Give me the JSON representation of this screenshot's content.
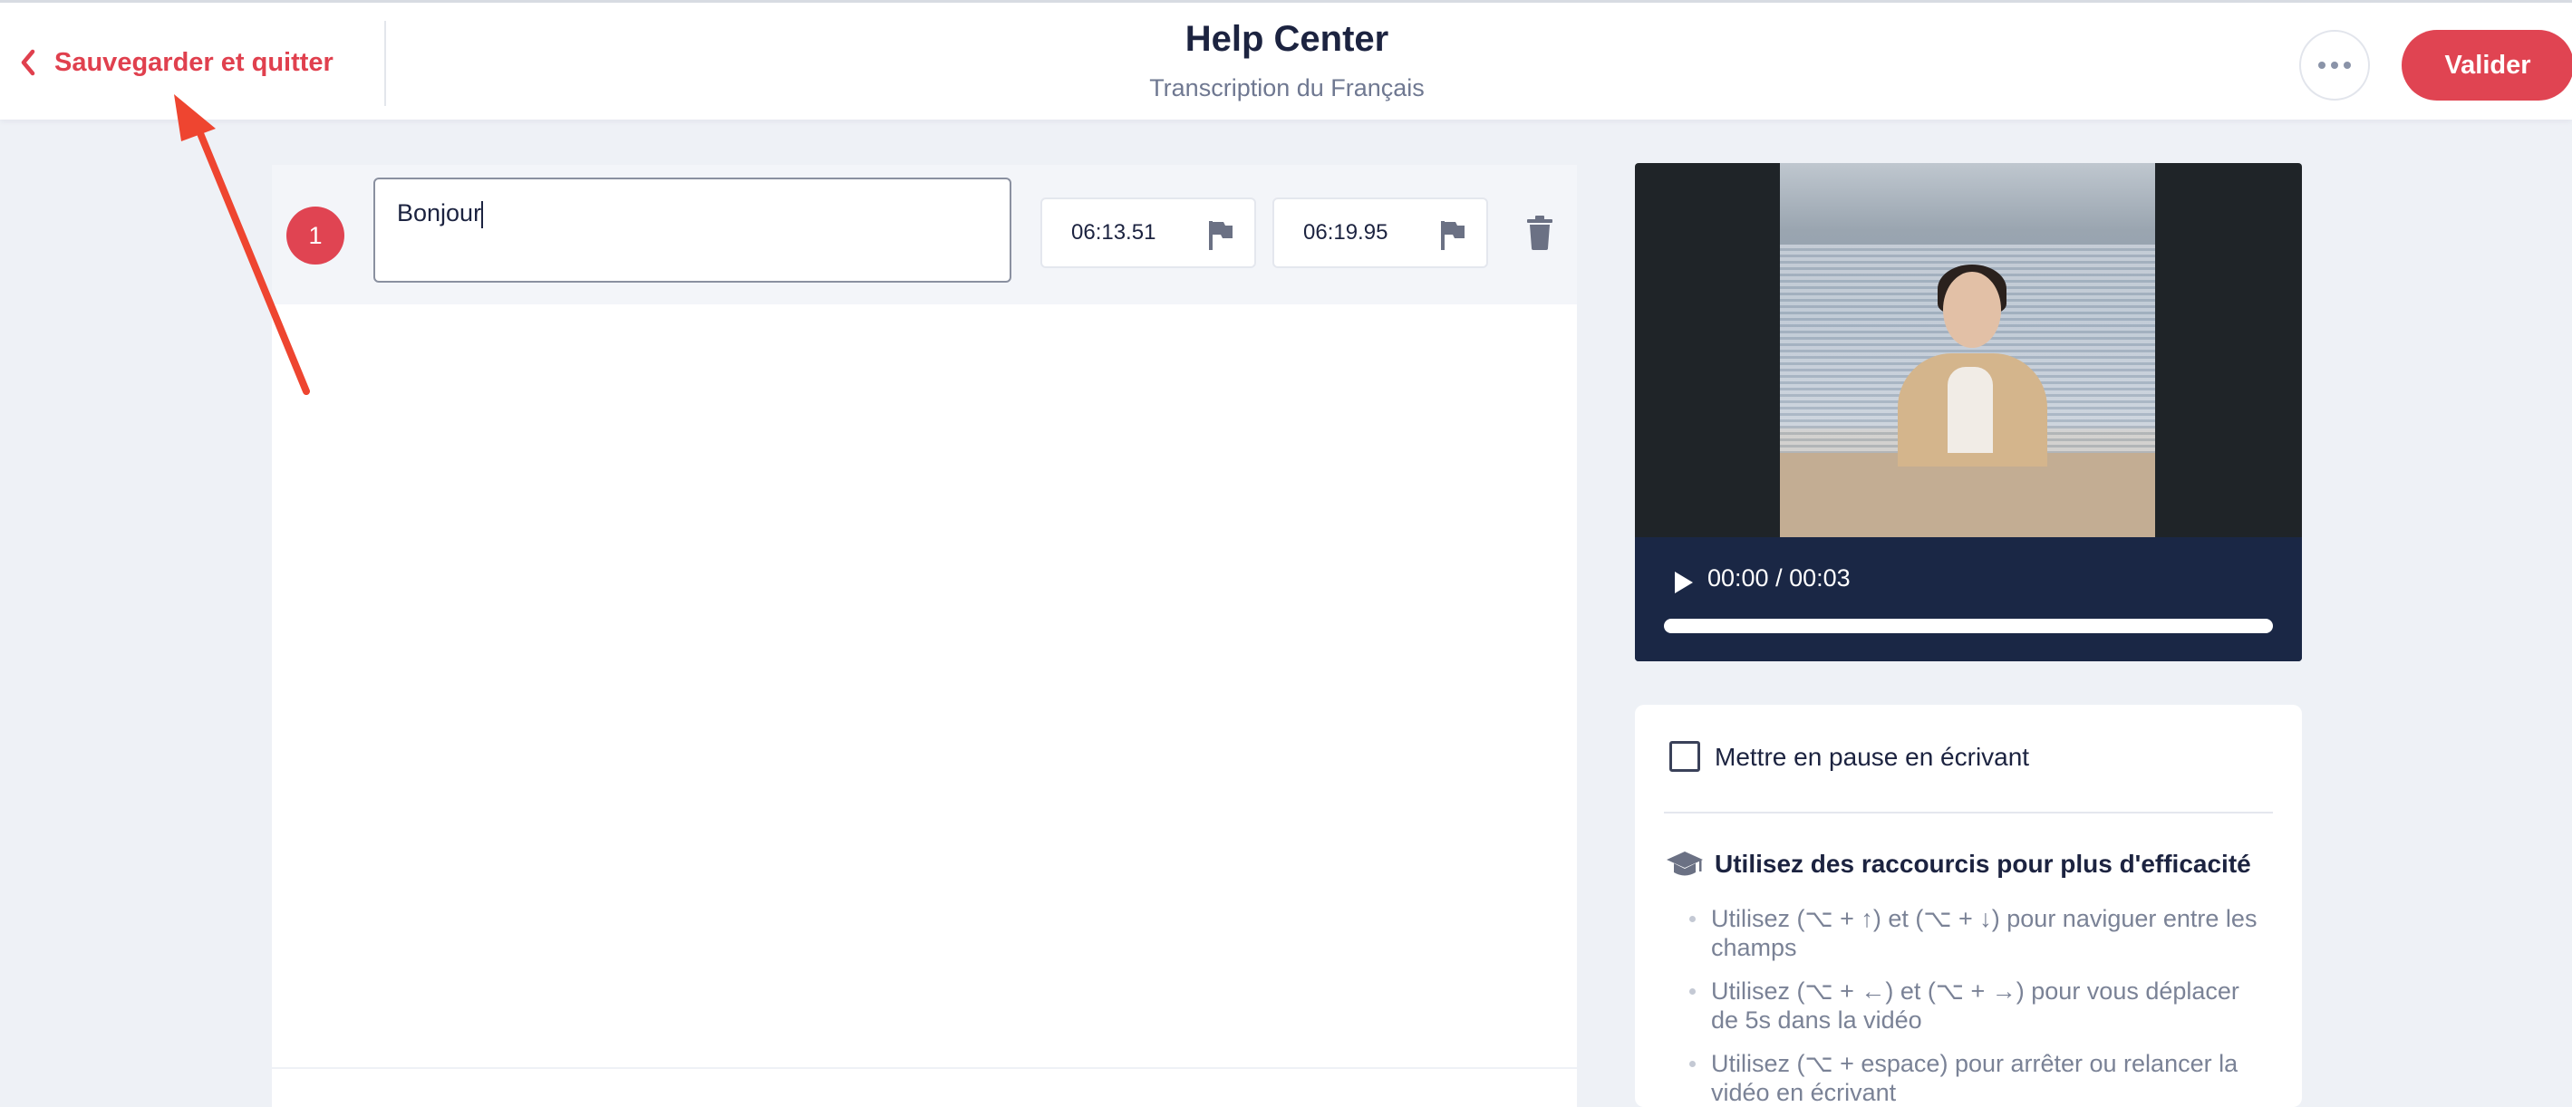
{
  "header": {
    "back_label": "Sauvegarder et quitter",
    "title": "Help Center",
    "subtitle": "Transcription du Français",
    "validate_label": "Valider"
  },
  "segments": [
    {
      "number": "1",
      "text": "Bonjour",
      "start_time": "06:13.51",
      "end_time": "06:19.95"
    }
  ],
  "video": {
    "time": "00:00 / 00:03",
    "progress": 0.0
  },
  "options": {
    "pause_label": "Mettre en pause en écrivant",
    "pause_checked": false,
    "tips_title": "Utilisez des raccourcis pour plus d'efficacité",
    "tips": [
      "Utilisez (⌥ + ↑) et (⌥ + ↓) pour naviguer entre les champs",
      "Utilisez (⌥ + ←) et (⌥ + →) pour vous déplacer de 5s dans la vidéo",
      "Utilisez (⌥ + espace) pour arrêter ou relancer la vidéo en écrivant"
    ]
  },
  "colors": {
    "accent": "#e04452",
    "video_controls_bg": "#1a2745",
    "annotation_arrow": "#ee4530"
  }
}
